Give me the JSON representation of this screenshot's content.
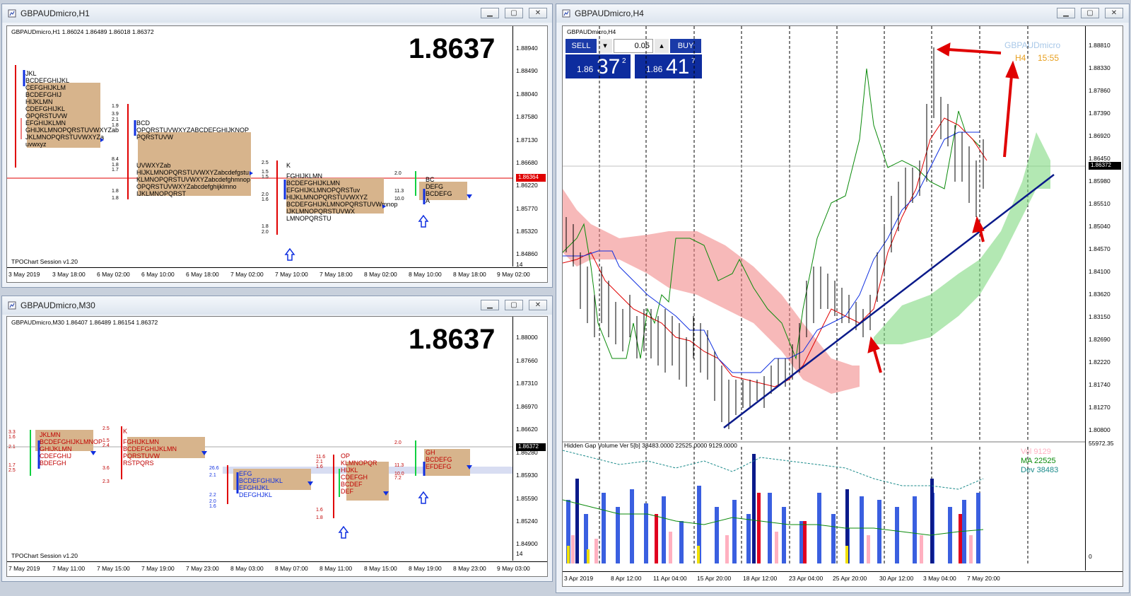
{
  "windows": {
    "h1": {
      "title": "GBPAUDmicro,H1",
      "ohlc": "GBPAUDmicro,H1  1.86024 1.86489 1.86018 1.86372",
      "big_price": "1.8637",
      "footer_label": "TPOChart Session v1.20",
      "price_tag": "1.86364",
      "axis_right": [
        "1.88940",
        "1.88490",
        "1.88040",
        "1.87580",
        "1.87130",
        "1.86680",
        "1.86220",
        "1.85770",
        "1.85320",
        "1.84860"
      ],
      "axis_bottom": [
        "3 May 2019",
        "3 May 18:00",
        "6 May 02:00",
        "6 May 10:00",
        "6 May 18:00",
        "7 May 02:00",
        "7 May 10:00",
        "7 May 18:00",
        "8 May 02:00",
        "8 May 10:00",
        "8 May 18:00",
        "9 May 02:00"
      ],
      "bottom_axis_value": "14"
    },
    "m30": {
      "title": "GBPAUDmicro,M30",
      "ohlc": "GBPAUDmicro,M30  1.86407 1.86489 1.86154 1.86372",
      "big_price": "1.8637",
      "footer_label": "TPOChart Session v1.20",
      "price_tag": "1.86372",
      "axis_right": [
        "1.88000",
        "1.87660",
        "1.87310",
        "1.86970",
        "1.86620",
        "1.86280",
        "1.85930",
        "1.85590",
        "1.85240",
        "1.84900"
      ],
      "axis_bottom": [
        "7 May 2019",
        "7 May 11:00",
        "7 May 15:00",
        "7 May 19:00",
        "7 May 23:00",
        "8 May 03:00",
        "8 May 07:00",
        "8 May 11:00",
        "8 May 15:00",
        "8 May 19:00",
        "8 May 23:00",
        "9 May 03:00"
      ],
      "bottom_axis_value": "14"
    },
    "h4": {
      "title": "GBPAUDmicro,H4",
      "sym_label": "GBPAUDmicro,H4",
      "watermark_symbol": "GBPAUDmicro",
      "watermark_tf": "H4",
      "watermark_time": "15:55",
      "price_tag": "1.86372",
      "axis_right": [
        "1.88810",
        "1.88330",
        "1.87860",
        "1.87390",
        "1.86920",
        "1.86450",
        "1.85980",
        "1.85510",
        "1.85040",
        "1.84570",
        "1.84100",
        "1.83620",
        "1.83150",
        "1.82690",
        "1.82220",
        "1.81740",
        "1.81270",
        "1.80800"
      ],
      "axis_bottom": [
        "3 Apr 2019",
        "8 Apr 12:00",
        "11 Apr 04:00",
        "15 Apr 20:00",
        "18 Apr 12:00",
        "23 Apr 04:00",
        "25 Apr 20:00",
        "30 Apr 12:00",
        "3 May 04:00",
        "7 May 20:00"
      ],
      "trade": {
        "sell": "SELL",
        "buy": "BUY",
        "lot": "0.05",
        "sell_pre": "1.86",
        "sell_big": "37",
        "sell_sup": "2",
        "buy_pre": "1.86",
        "buy_big": "41",
        "buy_sup": "7"
      },
      "volume": {
        "label": "Hidden Gap Volume Ver 5[b] 38483.0000 22525.0000 9129.0000",
        "axis_top": "55972.35",
        "axis_bottom": "0",
        "legend": [
          {
            "name": "Vol",
            "value": "9129",
            "color": "#ffb0c0"
          },
          {
            "name": "MA",
            "value": "22525",
            "color": "#0a8a0a"
          },
          {
            "name": "Dev",
            "value": "38483",
            "color": "#1a8a8a"
          }
        ]
      }
    }
  },
  "colors": {
    "sell_buy": "#1a3aa8",
    "profile": "#d7b48c",
    "price_line": "#e00000"
  }
}
